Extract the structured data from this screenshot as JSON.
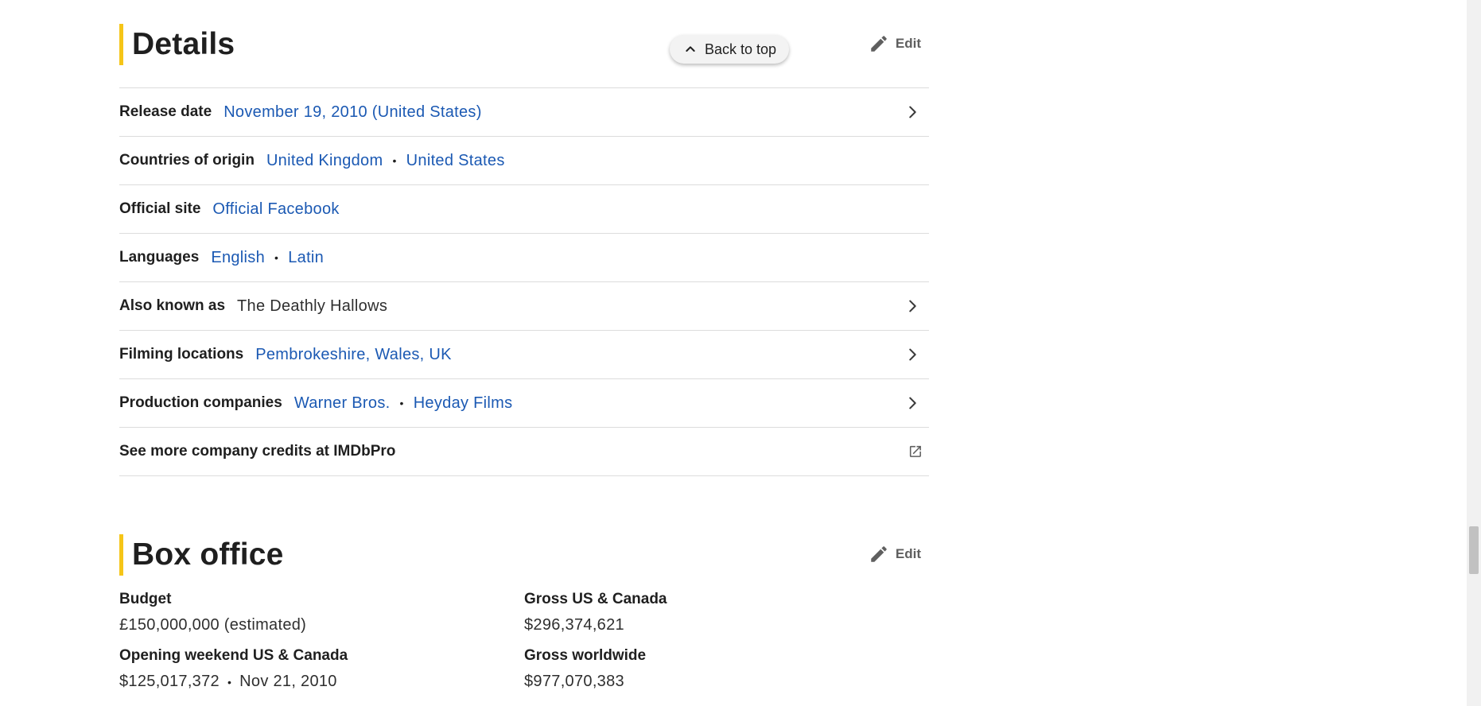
{
  "details": {
    "title": "Details",
    "edit_label": "Edit",
    "back_to_top": "Back to top",
    "rows": [
      {
        "label": "Release date",
        "values": [
          "November 19, 2010 (United States)"
        ]
      },
      {
        "label": "Countries of origin",
        "values": [
          "United Kingdom",
          "United States"
        ]
      },
      {
        "label": "Official site",
        "values": [
          "Official Facebook"
        ]
      },
      {
        "label": "Languages",
        "values": [
          "English",
          "Latin"
        ]
      },
      {
        "label": "Also known as",
        "values": [
          "The Deathly Hallows"
        ]
      },
      {
        "label": "Filming locations",
        "values": [
          "Pembrokeshire, Wales, UK"
        ]
      },
      {
        "label": "Production companies",
        "values": [
          "Warner Bros.",
          "Heyday Films"
        ]
      },
      {
        "label": "See more company credits at IMDbPro"
      }
    ]
  },
  "box_office": {
    "title": "Box office",
    "edit_label": "Edit",
    "budget_label": "Budget",
    "budget_value": "£150,000,000 (estimated)",
    "gross_us_label": "Gross US & Canada",
    "gross_us_value": "$296,374,621",
    "opening_label": "Opening weekend US & Canada",
    "opening_value": "$125,017,372",
    "opening_date": "Nov 21, 2010",
    "gross_world_label": "Gross worldwide",
    "gross_world_value": "$977,070,383"
  },
  "icons": {
    "edit": "pencil-icon",
    "chevron": "chevron-right-icon",
    "external": "external-link-icon",
    "back": "chevron-up-icon"
  },
  "colors": {
    "accent": "#f5c518",
    "link": "#1b59b3"
  }
}
